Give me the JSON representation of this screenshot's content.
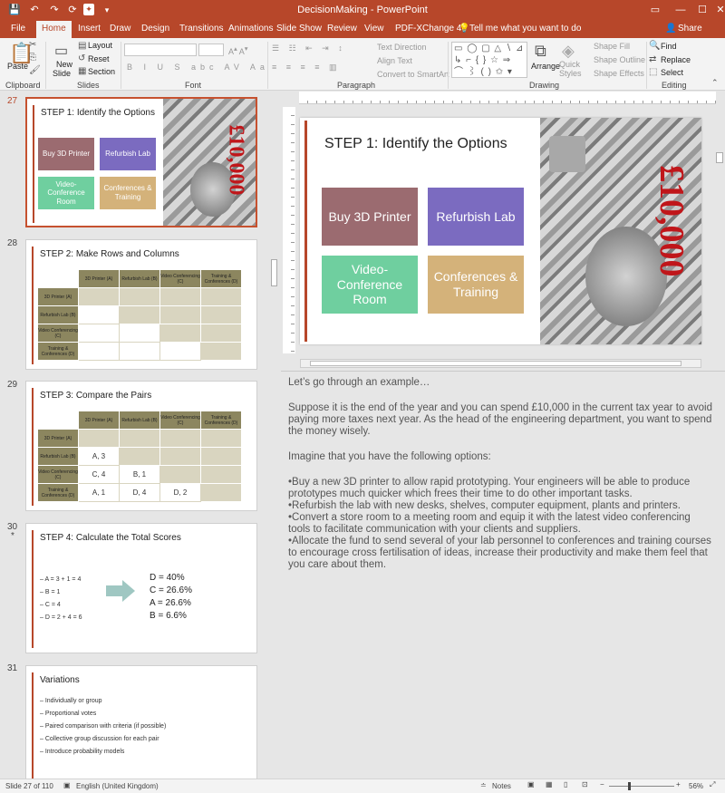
{
  "titlebar": {
    "title": "DecisionMaking  -  PowerPoint",
    "min": "—",
    "max": "☐",
    "close": "✕",
    "icons": [
      "save-icon",
      "undo-icon",
      "redo-icon",
      "refresh-icon",
      "pdf-icon",
      "customize-qat-icon"
    ]
  },
  "tabs": [
    "File",
    "Home",
    "Insert",
    "Draw",
    "Design",
    "Transitions",
    "Animations",
    "Slide Show",
    "Review",
    "View",
    "PDF-XChange 4"
  ],
  "tell_me": "Tell me what you want to do",
  "share": "Share",
  "ribbon": {
    "clipboard": {
      "group": "Clipboard",
      "paste": "Paste"
    },
    "slides": {
      "group": "Slides",
      "new_slide": "New",
      "new_slide2": "Slide",
      "layout": "Layout",
      "reset": "Reset",
      "section": "Section"
    },
    "font": {
      "group": "Font"
    },
    "paragraph": {
      "group": "Paragraph",
      "text_direction": "Text Direction",
      "align_text": "Align Text",
      "convert": "Convert to SmartArt"
    },
    "drawing": {
      "group": "Drawing",
      "arrange": "Arrange",
      "quick": "Quick",
      "styles": "Styles",
      "fill": "Shape Fill",
      "outline": "Shape Outline",
      "effects": "Shape Effects"
    },
    "editing": {
      "group": "Editing",
      "find": "Find",
      "replace": "Replace",
      "select": "Select"
    }
  },
  "thumbnails": [
    {
      "num": "27",
      "title": "STEP 1: Identify the Options"
    },
    {
      "num": "28",
      "title": "STEP 2: Make Rows and Columns"
    },
    {
      "num": "29",
      "title": "STEP 3: Compare the Pairs"
    },
    {
      "num": "30",
      "title": "STEP 4: Calculate the Total Scores"
    },
    {
      "num": "31",
      "title": "Variations"
    }
  ],
  "slide30_marker": "*",
  "options": [
    "Buy 3D Printer",
    "Refurbish Lab",
    "Video-Conference Room",
    "Conferences & Training"
  ],
  "amount": "£10,000",
  "grid": {
    "headers": [
      "3D Printer (A)",
      "Refurbish Lab (B)",
      "Video Conferencing (C)",
      "Training & Conferences (D)"
    ],
    "rows": [
      "3D Printer (A)",
      "Refurbish Lab (B)",
      "Video Conferencing (C)",
      "Training & Conferences (D)"
    ],
    "pairs": {
      "b_a": "A, 3",
      "c_a": "C, 4",
      "c_b": "B, 1",
      "d_a": "A, 1",
      "d_b": "D, 4",
      "d_c": "D, 2"
    }
  },
  "scores": {
    "left": [
      "– A = 3 + 1 = 4",
      "– B = 1",
      "– C = 4",
      "– D = 2 + 4 = 6"
    ],
    "right": [
      "D = 40%",
      "C = 26.6%",
      "A = 26.6%",
      "B = 6.6%"
    ]
  },
  "variations": [
    "Individually or group",
    "Proportional votes",
    "Paired comparison with criteria (if possible)",
    "Collective group discussion for each pair",
    "Introduce probability models"
  ],
  "main_title": "STEP 1: Identify the Options",
  "notes": [
    "Let’s go through an example…",
    "Suppose it is the end of the year and you can spend £10,000 in the current tax year to avoid paying more taxes next year. As the head of the engineering department, you want to spend the money wisely.",
    "Imagine that you have the following options:",
    "•Buy a new 3D printer to allow rapid prototyping. Your engineers will be able to produce prototypes much quicker which frees their time to do other important tasks.\n•Refurbish the lab with new desks, shelves, computer equipment, plants and printers.\n•Convert a store room to a meeting room and equip it with the latest video conferencing tools to facilitate communication with your clients and suppliers.\n•Allocate the fund to send several of your lab personnel to conferences and training courses to encourage cross fertilisation of ideas, increase their productivity and make them feel that you care about them."
  ],
  "status": {
    "slide": "Slide 27 of 110",
    "lang": "English (United Kingdom)",
    "notes": "Notes",
    "zoom": "56%"
  },
  "colors": {
    "accent": "#b7472a",
    "opt1": "#9b6b70",
    "opt2": "#7b6bc0",
    "opt3": "#6fcf9f",
    "opt4": "#d4b27a"
  }
}
